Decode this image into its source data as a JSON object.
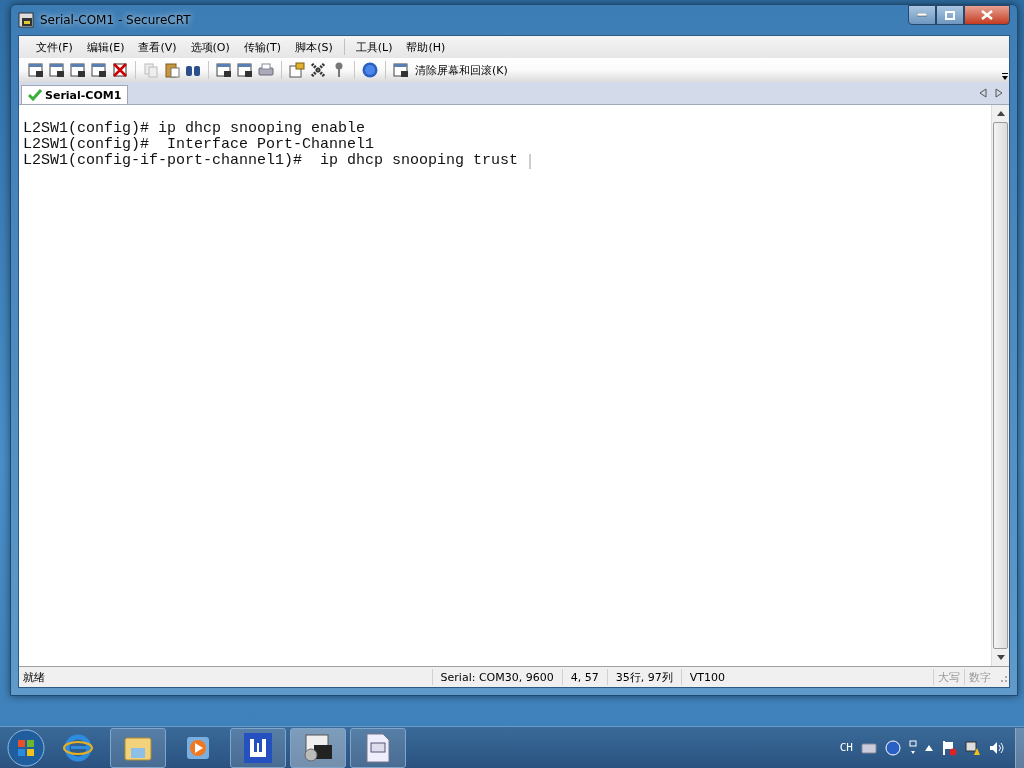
{
  "window": {
    "title": "Serial-COM1 - SecureCRT"
  },
  "menu": [
    "文件(F)",
    "编辑(E)",
    "查看(V)",
    "选项(O)",
    "传输(T)",
    "脚本(S)",
    "工具(L)",
    "帮助(H)"
  ],
  "toolbar": {
    "clear_button": "清除屏幕和回滚(K)"
  },
  "tabs": [
    {
      "label": "Serial-COM1",
      "selected": true
    }
  ],
  "terminal": {
    "lines": [
      "L2SW1(config)# ip dhcp snooping enable",
      "L2SW1(config)#  Interface Port-Channel1",
      "L2SW1(config-if-port-channel1)#  ip dhcp snooping trust "
    ]
  },
  "status_bar": {
    "message": "就绪",
    "fields": [
      "Serial: COM30, 9600",
      "4,  57",
      "35行, 97列",
      "VT100"
    ],
    "indicators": [
      {
        "label": "大写",
        "disabled": true
      },
      {
        "label": "数字",
        "disabled": true
      }
    ]
  },
  "tray": {
    "language": "CH"
  }
}
